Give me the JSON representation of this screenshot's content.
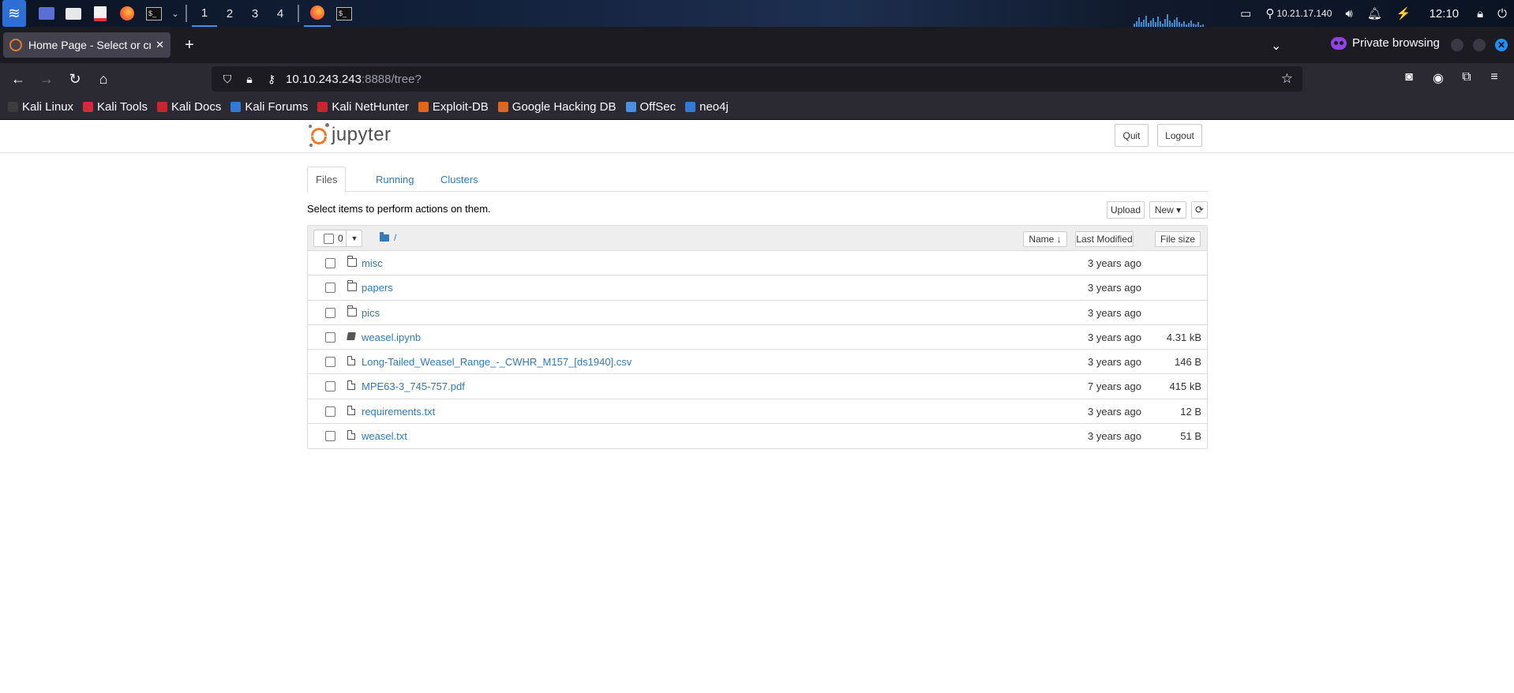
{
  "taskbar": {
    "workspaces": [
      "1",
      "2",
      "3",
      "4"
    ],
    "ip": "10.21.17.140",
    "time": "12:10"
  },
  "browser": {
    "tab_title": "Home Page - Select or create a notebook",
    "new_tab": "+",
    "private_label": "Private browsing",
    "url_host": "10.10.243.243",
    "url_rest": ":8888/tree?",
    "bookmarks": [
      {
        "label": "Kali Linux",
        "color": "#3c3c3c"
      },
      {
        "label": "Kali Tools",
        "color": "#d9283d"
      },
      {
        "label": "Kali Docs",
        "color": "#c8262e"
      },
      {
        "label": "Kali Forums",
        "color": "#2e7cd6"
      },
      {
        "label": "Kali NetHunter",
        "color": "#c8262e"
      },
      {
        "label": "Exploit-DB",
        "color": "#e0661f"
      },
      {
        "label": "Google Hacking DB",
        "color": "#e0661f"
      },
      {
        "label": "OffSec",
        "color": "#4a8fe0"
      },
      {
        "label": "neo4j",
        "color": "#2e7cd6"
      }
    ]
  },
  "jupyter": {
    "logo_text": "jupyter",
    "quit_label": "Quit",
    "logout_label": "Logout",
    "tabs": [
      "Files",
      "Running",
      "Clusters"
    ],
    "hint": "Select items to perform actions on them.",
    "upload_label": "Upload",
    "new_label": "New ▾",
    "refresh_icon": "⟳",
    "select_count": "0",
    "breadcrumb": "/",
    "col_name": "Name ↓",
    "col_modified": "Last Modified",
    "col_size": "File size",
    "files": [
      {
        "name": "misc",
        "type": "folder",
        "modified": "3 years ago",
        "size": ""
      },
      {
        "name": "papers",
        "type": "folder",
        "modified": "3 years ago",
        "size": ""
      },
      {
        "name": "pics",
        "type": "folder",
        "modified": "3 years ago",
        "size": ""
      },
      {
        "name": "weasel.ipynb",
        "type": "notebook",
        "modified": "3 years ago",
        "size": "4.31 kB"
      },
      {
        "name": "Long-Tailed_Weasel_Range_-_CWHR_M157_[ds1940].csv",
        "type": "file",
        "modified": "3 years ago",
        "size": "146 B"
      },
      {
        "name": "MPE63-3_745-757.pdf",
        "type": "file",
        "modified": "7 years ago",
        "size": "415 kB"
      },
      {
        "name": "requirements.txt",
        "type": "file",
        "modified": "3 years ago",
        "size": "12 B"
      },
      {
        "name": "weasel.txt",
        "type": "file",
        "modified": "3 years ago",
        "size": "51 B"
      }
    ]
  }
}
